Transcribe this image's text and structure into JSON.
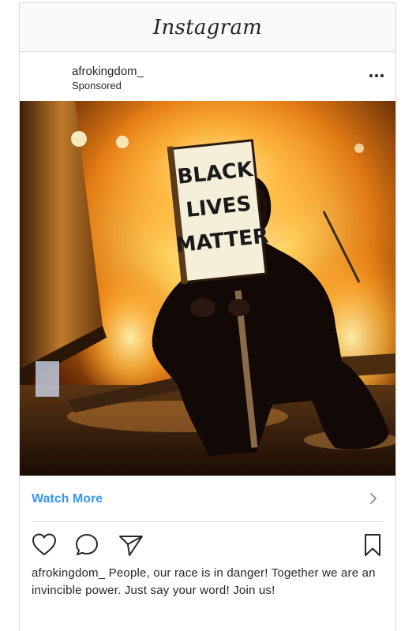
{
  "app": {
    "logo_text": "Instagram"
  },
  "post": {
    "username": "afrokingdom_",
    "sponsored_label": "Sponsored",
    "image": {
      "sign_lines": [
        "BLACK",
        "LIVES",
        "MATTER"
      ]
    },
    "cta": {
      "label": "Watch More"
    },
    "caption": {
      "username": "afrokingdom_",
      "text": " People, our race is in danger! Together we are an invincible power. Just say your word! Join us!"
    },
    "icons": [
      "heart-icon",
      "comment-icon",
      "share-icon",
      "bookmark-icon",
      "more-options-icon",
      "chevron-right-icon"
    ]
  },
  "colors": {
    "cta_blue": "#3897f0",
    "border": "#dbdbdb",
    "header_bg": "#fafafa"
  }
}
